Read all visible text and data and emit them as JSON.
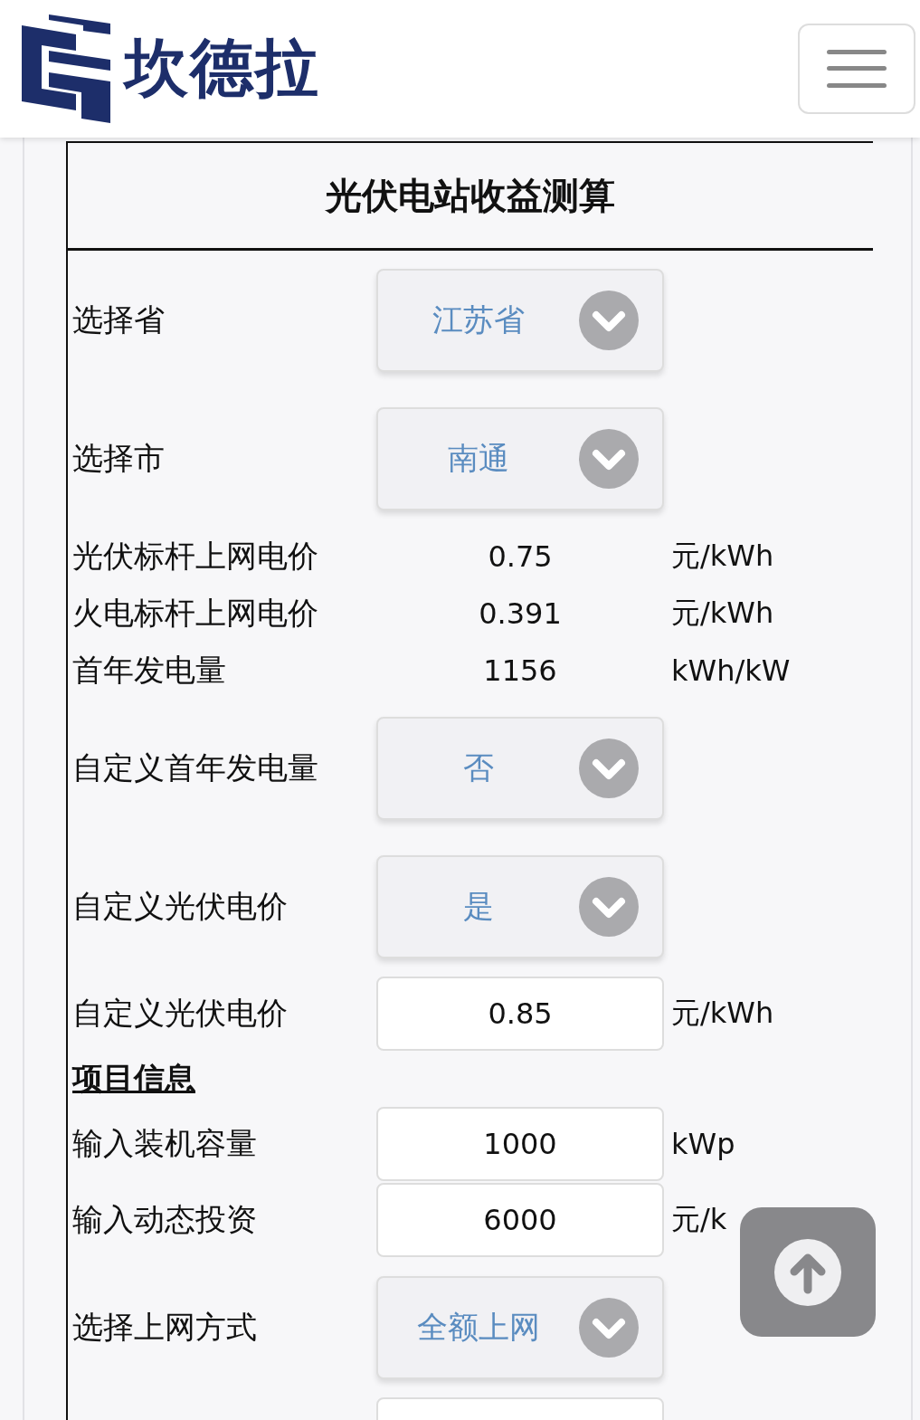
{
  "header": {
    "logo_text": "坎德拉"
  },
  "calculator": {
    "title": "光伏电站收益测算",
    "rows": [
      {
        "kind": "select",
        "label": "选择省",
        "value": "江苏省"
      },
      {
        "kind": "select",
        "label": "选择市",
        "value": "南通"
      },
      {
        "kind": "info",
        "label": "光伏标杆上网电价",
        "value": "0.75",
        "unit": "元/kWh"
      },
      {
        "kind": "info",
        "label": "火电标杆上网电价",
        "value": "0.391",
        "unit": "元/kWh"
      },
      {
        "kind": "info",
        "label": "首年发电量",
        "value": "1156",
        "unit": "kWh/kW"
      },
      {
        "kind": "select",
        "label": "自定义首年发电量",
        "value": "否"
      },
      {
        "kind": "select",
        "label": "自定义光伏电价",
        "value": "是"
      },
      {
        "kind": "input",
        "label": "自定义光伏电价",
        "value": "0.85",
        "unit": "元/kWh"
      },
      {
        "kind": "heading",
        "label": "项目信息"
      },
      {
        "kind": "input",
        "label": "输入装机容量",
        "value": "1000",
        "unit": "kWp"
      },
      {
        "kind": "input",
        "label": "输入动态投资",
        "value": "6000",
        "unit": "元/k"
      },
      {
        "kind": "select",
        "label": "选择上网方式",
        "value": "全额上网"
      },
      {
        "kind": "input"
      }
    ]
  }
}
